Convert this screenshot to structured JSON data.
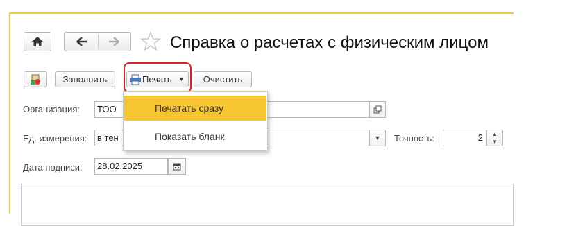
{
  "window": {
    "title": "Справка о расчетах с физическим лицом"
  },
  "nav": {
    "home_icon": "home-icon",
    "back_icon": "arrow-left-icon",
    "forward_icon": "arrow-right-icon",
    "favorite_icon": "star-icon"
  },
  "toolbar": {
    "fill_label": "Заполнить",
    "print_label": "Печать",
    "clear_label": "Очистить"
  },
  "print_menu": {
    "items": [
      {
        "label": "Печатать сразу",
        "active": true
      },
      {
        "label": "Показать бланк",
        "active": false
      }
    ]
  },
  "form": {
    "organization": {
      "label": "Организация:",
      "value": "ТОО"
    },
    "unit": {
      "label": "Ед. измерения:",
      "value": "в тен"
    },
    "precision": {
      "label": "Точность:",
      "value": "2"
    },
    "sign_date": {
      "label": "Дата подписи:",
      "value": "28.02.2025"
    }
  },
  "colors": {
    "accent": "#f7c531",
    "highlight_outline": "#e02020",
    "frame": "#f2c94c"
  }
}
